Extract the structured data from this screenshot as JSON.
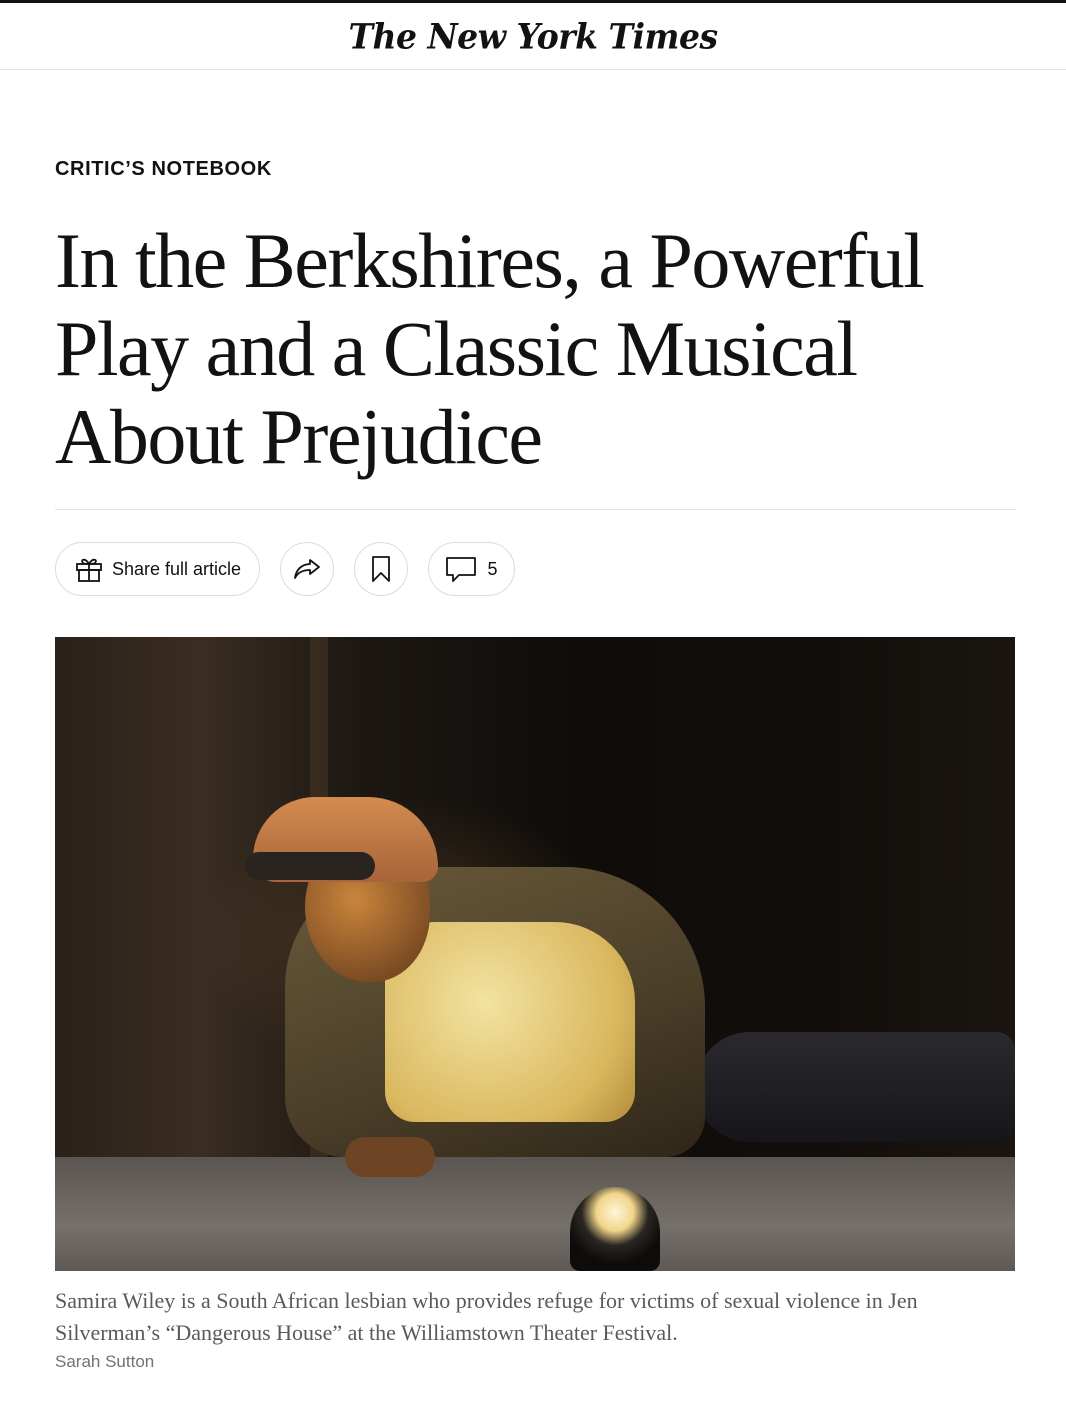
{
  "masthead": {
    "logo_text": "The New York Times"
  },
  "article": {
    "kicker": "CRITIC’S NOTEBOOK",
    "headline": "In the Berkshires, a Powerful Play and a Classic Musical About Prejudice"
  },
  "actions": {
    "share_label": "Share full article",
    "share_icon": "gift-icon",
    "forward_icon": "share-arrow-icon",
    "save_icon": "bookmark-icon",
    "comments_icon": "comment-icon",
    "comments_count": "5"
  },
  "photo": {
    "caption": "Samira Wiley is a South African lesbian who provides refuge for victims of sexual violence in Jen Silverman’s “Dangerous House” at the Williamstown Theater Festival.",
    "credit": "Sarah Sutton"
  }
}
